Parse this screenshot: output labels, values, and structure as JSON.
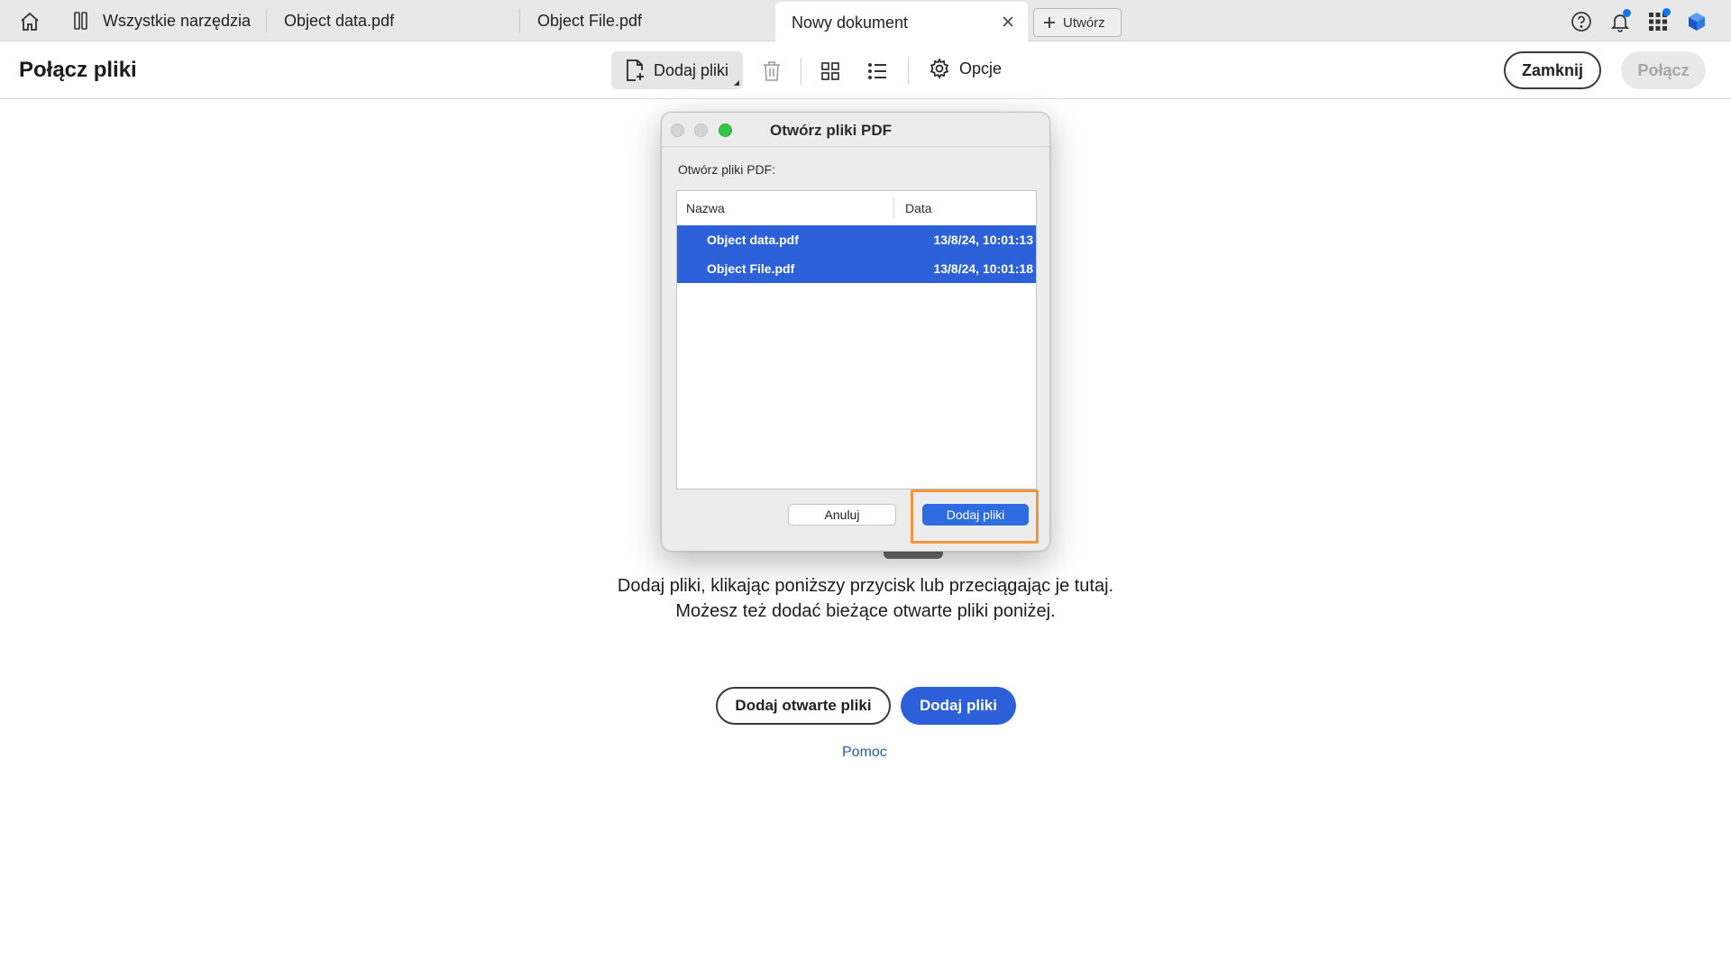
{
  "tabs": [
    {
      "label": "Wszystkie narzędzia"
    },
    {
      "label": "Object data.pdf"
    },
    {
      "label": "Object File.pdf"
    },
    {
      "label": "Nowy dokument"
    }
  ],
  "tabbar": {
    "create_label": "Utwórz"
  },
  "toolbar": {
    "title": "Połącz pliki",
    "add_files_label": "Dodaj pliki",
    "options_label": "Opcje",
    "close_label": "Zamknij",
    "combine_label": "Połącz"
  },
  "main": {
    "hint_line1": "Dodaj pliki, klikając poniższy przycisk lub przeciągając je tutaj.",
    "hint_line2": "Możesz też dodać bieżące otwarte pliki poniżej.",
    "add_open_label": "Dodaj otwarte pliki",
    "add_files_label": "Dodaj pliki",
    "help_label": "Pomoc"
  },
  "dialog": {
    "title": "Otwórz pliki PDF",
    "label": "Otwórz pliki PDF:",
    "columns": {
      "name": "Nazwa",
      "date": "Data"
    },
    "files": [
      {
        "name": "Object data.pdf",
        "date": "13/8/24, 10:01:13"
      },
      {
        "name": "Object File.pdf",
        "date": "13/8/24, 10:01:18"
      }
    ],
    "cancel_label": "Anuluj",
    "add_label": "Dodaj pliki"
  },
  "colors": {
    "accent": "#2c5fd8",
    "selection": "#2d61d9",
    "highlight": "#ee9640"
  }
}
